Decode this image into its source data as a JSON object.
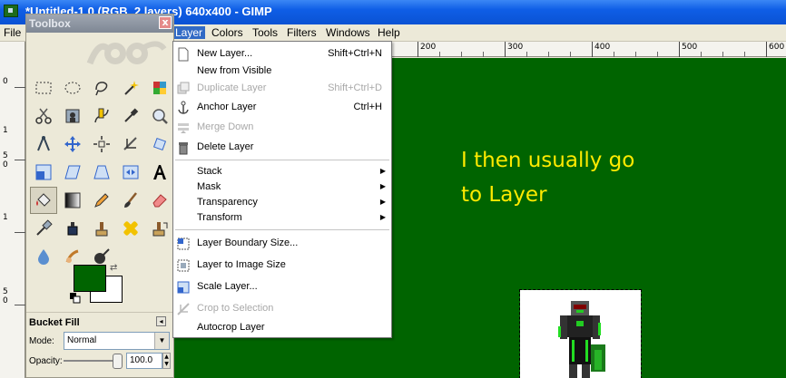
{
  "window": {
    "title": "*Untitled-1.0 (RGB, 2 layers) 640x400 - GIMP"
  },
  "menubar": {
    "items": [
      {
        "label": "File"
      },
      {
        "label": "Layer"
      },
      {
        "label": "Colors"
      },
      {
        "label": "Tools"
      },
      {
        "label": "Filters"
      },
      {
        "label": "Windows"
      },
      {
        "label": "Help"
      }
    ]
  },
  "ruler": {
    "labels": [
      "200",
      "300",
      "400",
      "500",
      "600"
    ],
    "vlabels": [
      "0",
      "1",
      "5",
      "0",
      "1",
      "5",
      "0"
    ]
  },
  "toolbox": {
    "title": "Toolbox",
    "close": "x"
  },
  "tool_options": {
    "title": "Bucket Fill",
    "mode_label": "Mode:",
    "mode_value": "Normal",
    "opacity_label": "Opacity:",
    "opacity_value": "100.0",
    "opacity_level": 100
  },
  "colors": {
    "foreground": "#006400",
    "background": "#ffffff",
    "canvas": "#006400",
    "annotation": "#ffea00",
    "menu_highlight": "#316ac5"
  },
  "canvas": {
    "annotation_line1": "I then usually go",
    "annotation_line2": "to Layer"
  },
  "layer_menu": {
    "items": [
      {
        "label": "New Layer...",
        "shortcut": "Shift+Ctrl+N",
        "icon": "new-layer-icon",
        "enabled": true
      },
      {
        "label": "New from Visible",
        "shortcut": "",
        "icon": "",
        "enabled": true
      },
      {
        "label": "Duplicate Layer",
        "shortcut": "Shift+Ctrl+D",
        "icon": "duplicate-layer-icon",
        "enabled": false
      },
      {
        "label": "Anchor Layer",
        "shortcut": "Ctrl+H",
        "icon": "anchor-icon",
        "enabled": true
      },
      {
        "label": "Merge Down",
        "shortcut": "",
        "icon": "merge-down-icon",
        "enabled": false
      },
      {
        "label": "Delete Layer",
        "shortcut": "",
        "icon": "trash-icon",
        "enabled": true
      },
      {
        "label": "Stack",
        "submenu": true,
        "enabled": true
      },
      {
        "label": "Mask",
        "submenu": true,
        "enabled": true
      },
      {
        "label": "Transparency",
        "submenu": true,
        "enabled": true
      },
      {
        "label": "Transform",
        "submenu": true,
        "enabled": true
      },
      {
        "label": "Layer Boundary Size...",
        "icon": "layer-boundary-icon",
        "enabled": true
      },
      {
        "label": "Layer to Image Size",
        "icon": "layer-to-image-icon",
        "enabled": true
      },
      {
        "label": "Scale Layer...",
        "icon": "scale-layer-icon",
        "enabled": true
      },
      {
        "label": "Crop to Selection",
        "icon": "crop-icon",
        "enabled": false
      },
      {
        "label": "Autocrop Layer",
        "icon": "",
        "enabled": true
      }
    ]
  }
}
